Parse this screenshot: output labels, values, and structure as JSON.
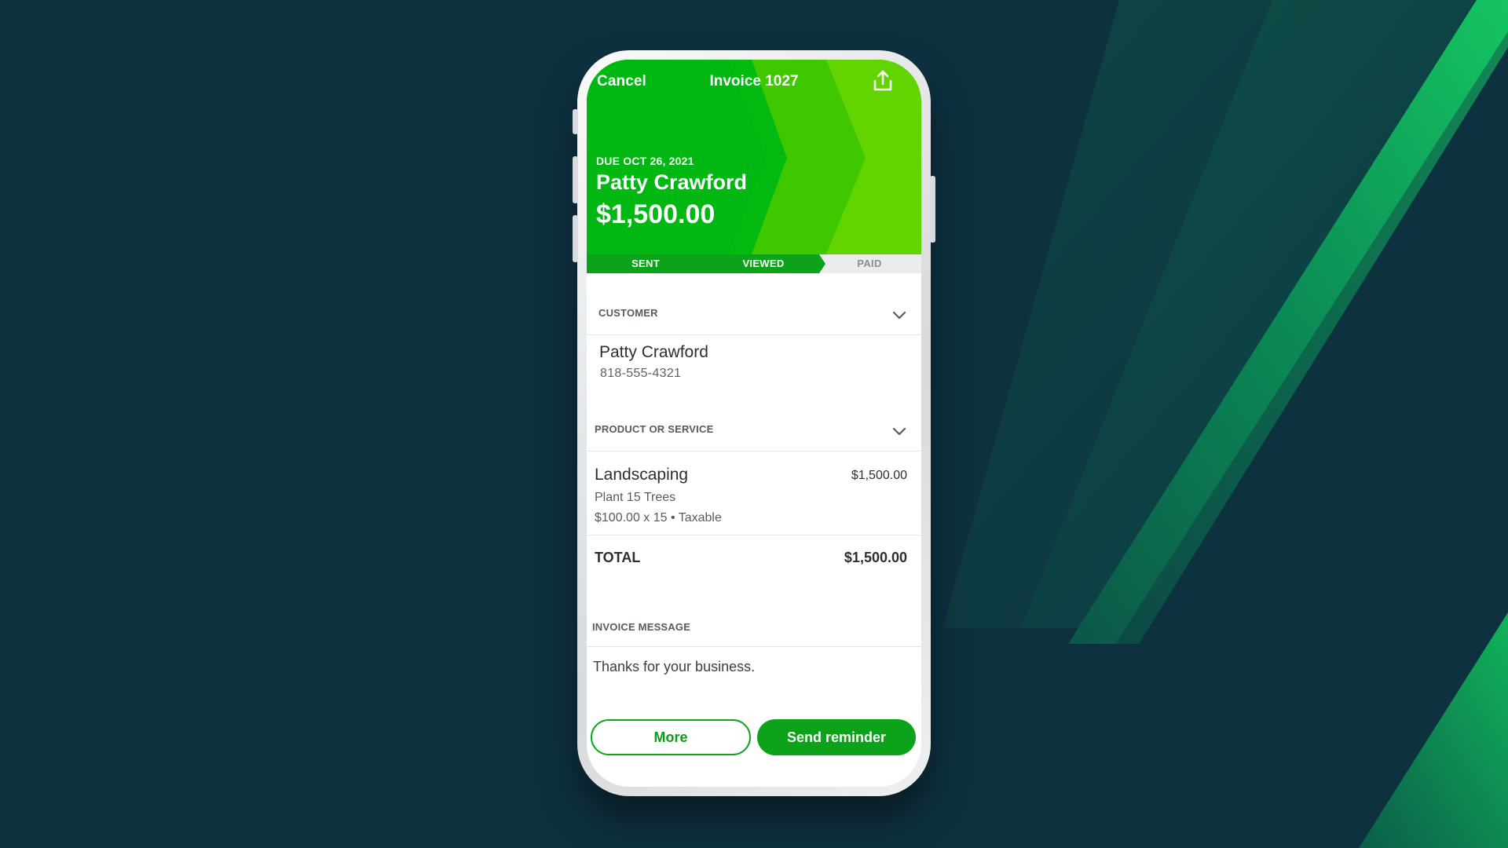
{
  "header": {
    "cancel_label": "Cancel",
    "title": "Invoice 1027",
    "share_icon": "share-icon",
    "due_label": "DUE OCT 26, 2021",
    "customer_name": "Patty Crawford",
    "amount": "$1,500.00"
  },
  "status_steps": {
    "sent": "SENT",
    "viewed": "VIEWED",
    "paid": "PAID",
    "current": "VIEWED"
  },
  "customer": {
    "section_label": "CUSTOMER",
    "name": "Patty Crawford",
    "phone": "818-555-4321"
  },
  "product": {
    "section_label": "PRODUCT OR SERVICE",
    "item_name": "Landscaping",
    "item_price": "$1,500.00",
    "item_description": "Plant 15 Trees",
    "item_rate": "$100.00 x 15 • Taxable"
  },
  "total": {
    "label": "TOTAL",
    "value": "$1,500.00"
  },
  "message": {
    "section_label": "INVOICE MESSAGE",
    "text": "Thanks for your business."
  },
  "actions": {
    "more_label": "More",
    "send_label": "Send reminder"
  },
  "colors": {
    "background": "#0e3140",
    "brand_green": "#0ca21a",
    "header_light_green": "#62d400",
    "header_mid_green": "#3ec600",
    "header_dark_green": "#00b813"
  }
}
